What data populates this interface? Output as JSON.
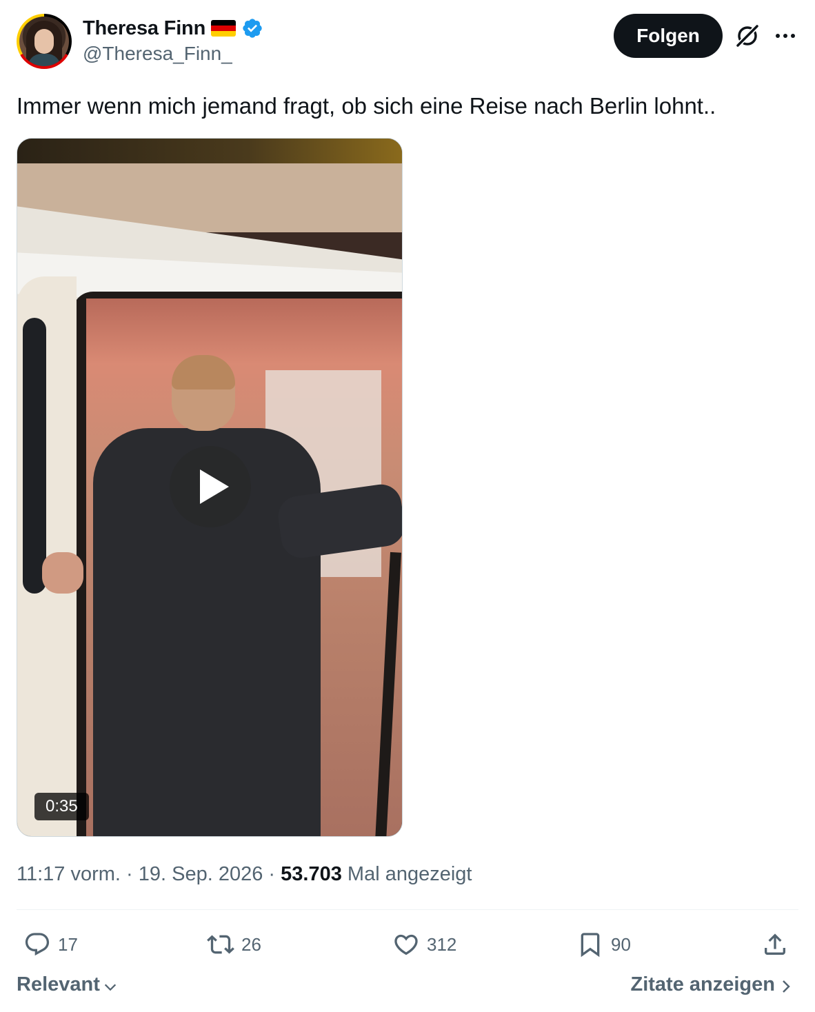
{
  "author": {
    "display_name": "Theresa Finn",
    "handle": "@Theresa_Finn_",
    "flag_colors": [
      "#000000",
      "#dd0000",
      "#ffce00"
    ],
    "verified_color": "#1d9bf0"
  },
  "header": {
    "follow_label": "Folgen",
    "icons": [
      "grok-icon",
      "more-icon"
    ]
  },
  "tweet": {
    "text": "Immer wenn mich jemand fragt, ob sich eine Reise nach Berlin lohnt.."
  },
  "media": {
    "duration": "0:35",
    "icon": "play-icon"
  },
  "meta": {
    "time": "11:17 vorm.",
    "sep1": " · ",
    "date": "19. Sep. 2026",
    "sep2": " · ",
    "views_count": "53.703",
    "views_label": " Mal angezeigt"
  },
  "actions": {
    "replies": "17",
    "retweets": "26",
    "likes": "312",
    "bookmarks": "90"
  },
  "footer": {
    "sort_label": "Relevant",
    "quotes_label": "Zitate anzeigen"
  },
  "colors": {
    "text": "#0f1419",
    "secondary": "#536471",
    "accent": "#1d9bf0"
  }
}
